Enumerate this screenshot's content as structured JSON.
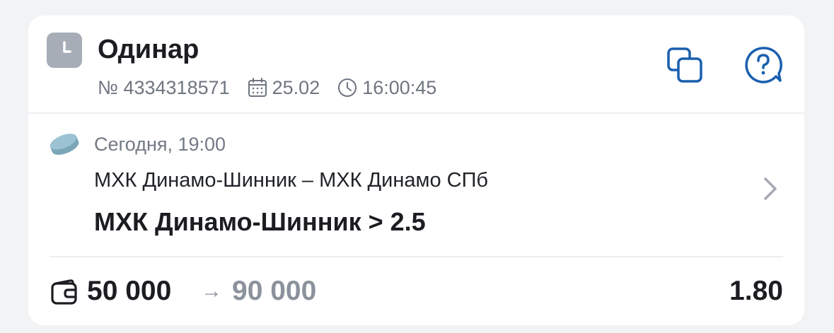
{
  "bet": {
    "type": "Одинар",
    "number": "№ 4334318571",
    "date": "25.02",
    "time": "16:00:45",
    "status_icon": "clock-icon"
  },
  "actions": {
    "copy_icon": "copy-icon",
    "help_icon": "question-bubble-icon"
  },
  "event": {
    "sport_icon": "hockey-puck-icon",
    "start_time": "Сегодня, 19:00",
    "match": "МХК Динамо-Шинник – МХК Динамо СПб",
    "outcome": "МХК Динамо-Шинник > 2.5"
  },
  "summary": {
    "stake": "50 000",
    "arrow": "→",
    "payout": "90 000",
    "odds": "1.80"
  },
  "colors": {
    "accent": "#1a5fae",
    "status_gray": "#a7adb7",
    "sport_icon": "#8fb7c8"
  }
}
